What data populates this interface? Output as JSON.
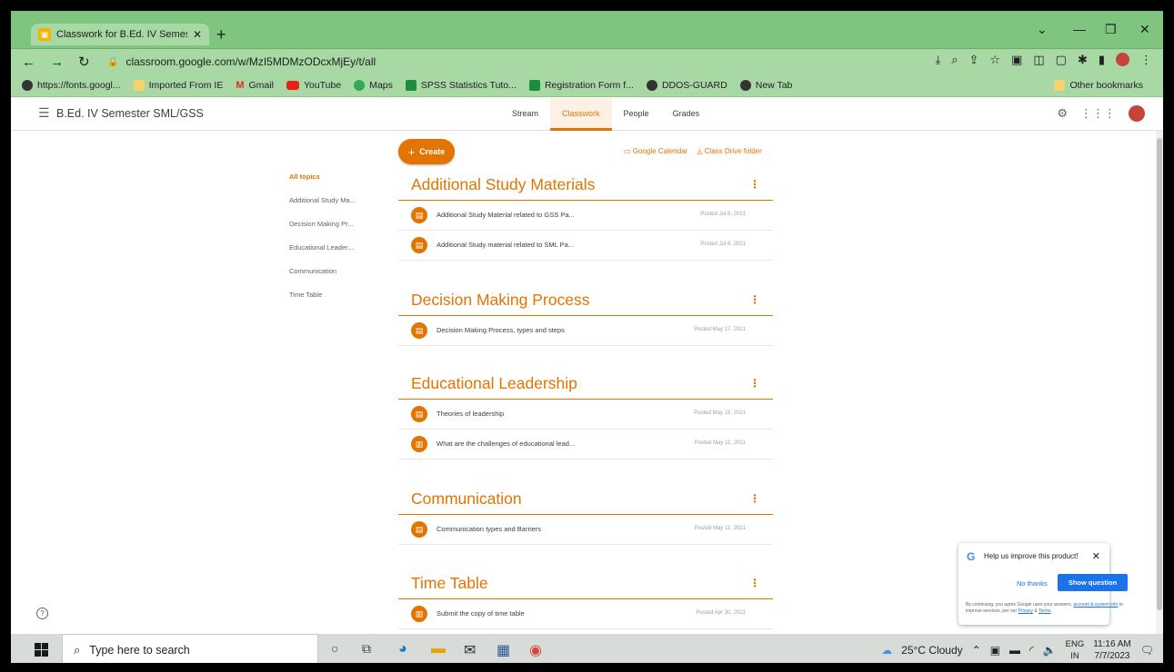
{
  "browser": {
    "tab_title": "Classwork for B.Ed. IV Semester S",
    "url": "classroom.google.com/w/MzI5MDMzODcxMjEy/t/all",
    "bookmarks": [
      {
        "label": "https://fonts.googl...",
        "icon": "globe-icon"
      },
      {
        "label": "Imported From IE",
        "icon": "folder-icon"
      },
      {
        "label": "Gmail",
        "icon": "gmail-icon"
      },
      {
        "label": "YouTube",
        "icon": "youtube-icon"
      },
      {
        "label": "Maps",
        "icon": "maps-icon"
      },
      {
        "label": "SPSS Statistics Tuto...",
        "icon": "spss-icon"
      },
      {
        "label": "Registration Form f...",
        "icon": "form-icon"
      },
      {
        "label": "DDOS-GUARD",
        "icon": "globe-icon"
      },
      {
        "label": "New Tab",
        "icon": "globe-icon"
      }
    ],
    "other_bookmarks": "Other bookmarks"
  },
  "classroom": {
    "class_name": "B.Ed. IV Semester SML/GSS",
    "tabs": [
      {
        "label": "Stream",
        "active": false
      },
      {
        "label": "Classwork",
        "active": true
      },
      {
        "label": "People",
        "active": false
      },
      {
        "label": "Grades",
        "active": false
      }
    ],
    "create_label": "Create",
    "calendar_link": "Google Calendar",
    "drive_link": "Class Drive folder",
    "topics": [
      "All topics",
      "Additional Study Ma...",
      "Decision Making Pr...",
      "Educational Leader...",
      "Communication",
      "Time Table"
    ],
    "sections": [
      {
        "title": "Additional Study Materials",
        "items": [
          {
            "title": "Additional Study Material related to GSS Pa...",
            "date": "Posted Jul 6, 2021",
            "icon": "material-icon"
          },
          {
            "title": "Additional Study material related to SML Pa...",
            "date": "Posted Jul 6, 2021",
            "icon": "material-icon"
          }
        ]
      },
      {
        "title": "Decision Making Process",
        "items": [
          {
            "title": "Decision Making Process, types and steps",
            "date": "Posted May 17, 2021",
            "icon": "material-icon"
          }
        ]
      },
      {
        "title": "Educational Leadership",
        "items": [
          {
            "title": "Theories of leadership",
            "date": "Posted May 15, 2021",
            "icon": "material-icon"
          },
          {
            "title": "What are the challenges of educational lead...",
            "date": "Posted May 11, 2021",
            "icon": "assignment-icon"
          }
        ]
      },
      {
        "title": "Communication",
        "items": [
          {
            "title": "Communication types and Barriers",
            "date": "Posted May 11, 2021",
            "icon": "material-icon"
          }
        ]
      },
      {
        "title": "Time Table",
        "items": [
          {
            "title": "Submit the copy of time table",
            "date": "Posted Apr 30, 2021",
            "icon": "assignment-icon"
          }
        ]
      }
    ]
  },
  "survey": {
    "title": "Help us improve this product!",
    "no_thanks": "No thanks",
    "show_question": "Show question",
    "footer_prefix": "By continuing, you agree Google uses your answers,",
    "footer_link1": "account & system info",
    "footer_mid": "to improve services, per our",
    "footer_link2": "Privacy",
    "footer_and": "&",
    "footer_link3": "Terms"
  },
  "taskbar": {
    "search_placeholder": "Type here to search",
    "weather": "25°C  Cloudy",
    "lang_top": "ENG",
    "lang_bottom": "IN",
    "time": "11:16 AM",
    "date": "7/7/2023"
  },
  "colors": {
    "accent": "#e37400",
    "chrome_green": "#7fc47f",
    "link_blue": "#1a73e8"
  }
}
